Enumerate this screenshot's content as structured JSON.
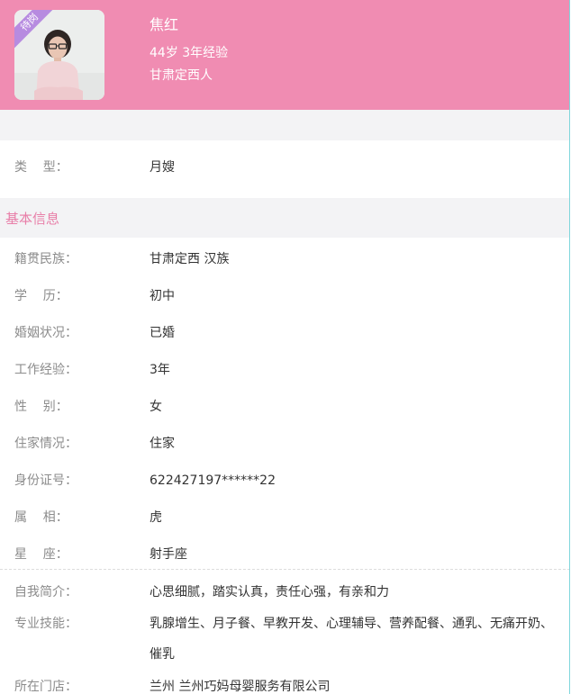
{
  "profile": {
    "badge": "待岗",
    "name": "焦红",
    "age_experience": "44岁 3年经验",
    "hometown": "甘肃定西人"
  },
  "type_row": {
    "label": "类    型：",
    "value": "月嫂"
  },
  "section": {
    "title": "基本信息"
  },
  "basic_info": [
    {
      "label": "籍贯民族：",
      "value": "甘肃定西 汉族"
    },
    {
      "label": "学    历：",
      "value": "初中"
    },
    {
      "label": "婚姻状况：",
      "value": "已婚"
    },
    {
      "label": "工作经验：",
      "value": "3年"
    },
    {
      "label": "性    别：",
      "value": "女"
    },
    {
      "label": "住家情况：",
      "value": "住家"
    },
    {
      "label": "身份证号：",
      "value": "622427197******22"
    },
    {
      "label": "属    相：",
      "value": "虎"
    },
    {
      "label": "星    座：",
      "value": "射手座"
    }
  ],
  "intro": {
    "label": "自我简介：",
    "value": "心思细腻，踏实认真，责任心强，有亲和力"
  },
  "skills": {
    "label": "专业技能：",
    "value": "乳腺增生、月子餐、早教开发、心理辅导、营养配餐、通乳、无痛开奶、催乳"
  },
  "store": {
    "label": "所在门店：",
    "value": "兰州 兰州巧妈母婴服务有限公司"
  },
  "colors": {
    "header_bg": "#f08cb2",
    "badge_bg": "#b78be0",
    "section_title": "#e87ea8",
    "page_gap_bg": "#f3f3f5"
  },
  "icons": {
    "avatar": "person-photo"
  }
}
